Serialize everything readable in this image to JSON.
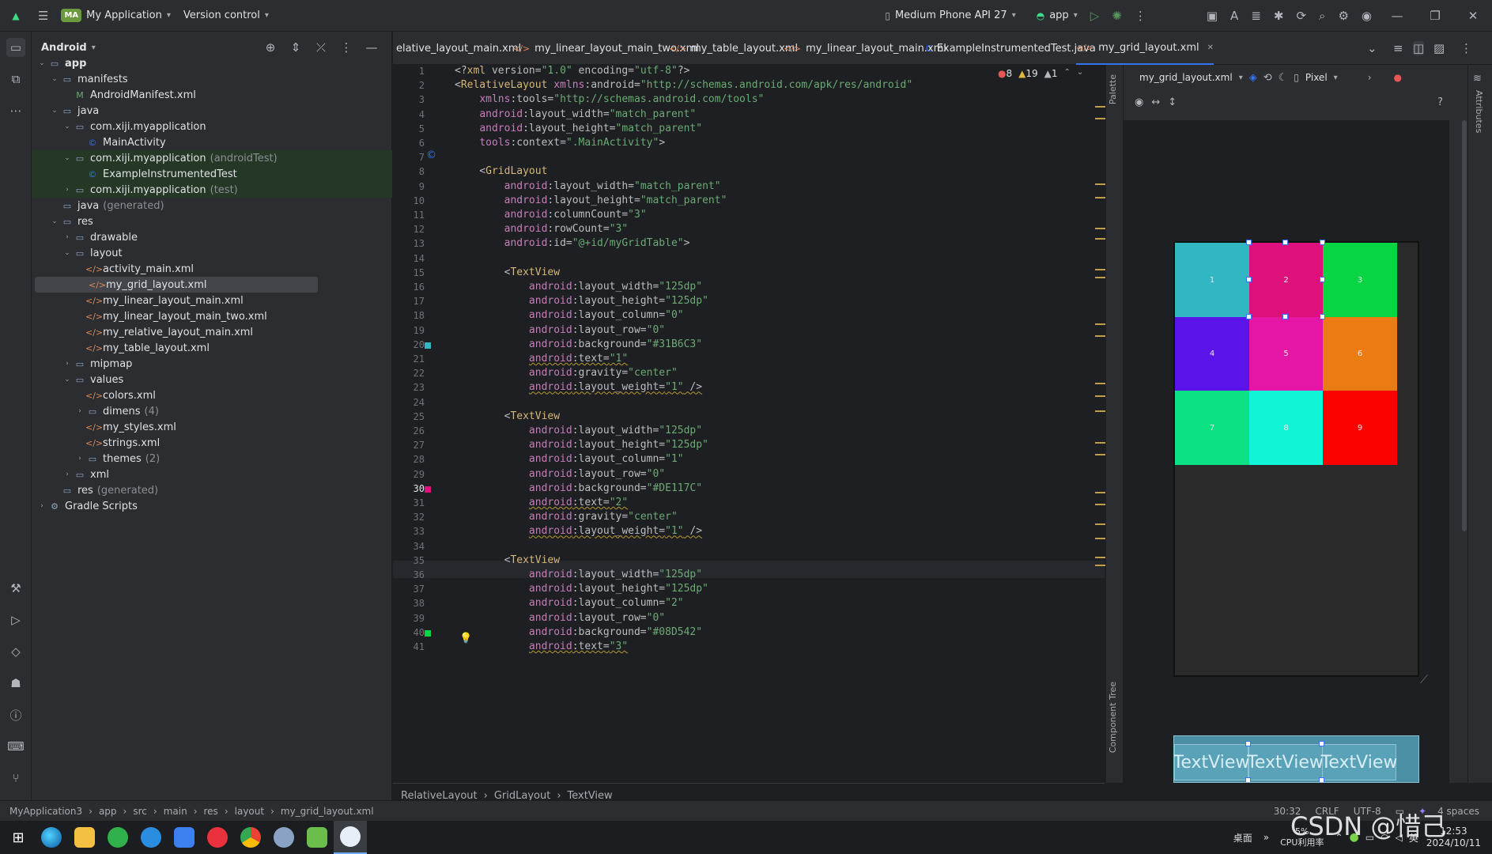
{
  "titlebar": {
    "app_badge": "MA",
    "app_name": "My Application",
    "vcs": "Version control",
    "device": "Medium Phone API 27",
    "run_config": "app"
  },
  "project": {
    "view": "Android",
    "tree": [
      {
        "label": "app",
        "depth": 0,
        "arrow": "v",
        "icon": "folder",
        "bold": true
      },
      {
        "label": "manifests",
        "depth": 1,
        "arrow": "v",
        "icon": "folder"
      },
      {
        "label": "AndroidManifest.xml",
        "depth": 2,
        "arrow": "",
        "icon": "manifest"
      },
      {
        "label": "java",
        "depth": 1,
        "arrow": "v",
        "icon": "folder"
      },
      {
        "label": "com.xiji.myapplication",
        "depth": 2,
        "arrow": "v",
        "icon": "package"
      },
      {
        "label": "MainActivity",
        "depth": 3,
        "arrow": "",
        "icon": "class"
      },
      {
        "label": "com.xiji.myapplication",
        "depth": 2,
        "arrow": "v",
        "icon": "package",
        "suffix": "(androidTest)",
        "green": true
      },
      {
        "label": "ExampleInstrumentedTest",
        "depth": 3,
        "arrow": "",
        "icon": "class",
        "green": true
      },
      {
        "label": "com.xiji.myapplication",
        "depth": 2,
        "arrow": ">",
        "icon": "package",
        "suffix": "(test)",
        "green": true
      },
      {
        "label": "java",
        "depth": 1,
        "arrow": "",
        "icon": "folder",
        "suffix": "(generated)"
      },
      {
        "label": "res",
        "depth": 1,
        "arrow": "v",
        "icon": "folder"
      },
      {
        "label": "drawable",
        "depth": 2,
        "arrow": ">",
        "icon": "folder"
      },
      {
        "label": "layout",
        "depth": 2,
        "arrow": "v",
        "icon": "folder"
      },
      {
        "label": "activity_main.xml",
        "depth": 3,
        "arrow": "",
        "icon": "xml"
      },
      {
        "label": "my_grid_layout.xml",
        "depth": 3,
        "arrow": "",
        "icon": "xml",
        "selected": true
      },
      {
        "label": "my_linear_layout_main.xml",
        "depth": 3,
        "arrow": "",
        "icon": "xml"
      },
      {
        "label": "my_linear_layout_main_two.xml",
        "depth": 3,
        "arrow": "",
        "icon": "xml"
      },
      {
        "label": "my_relative_layout_main.xml",
        "depth": 3,
        "arrow": "",
        "icon": "xml"
      },
      {
        "label": "my_table_layout.xml",
        "depth": 3,
        "arrow": "",
        "icon": "xml"
      },
      {
        "label": "mipmap",
        "depth": 2,
        "arrow": ">",
        "icon": "folder"
      },
      {
        "label": "values",
        "depth": 2,
        "arrow": "v",
        "icon": "folder"
      },
      {
        "label": "colors.xml",
        "depth": 3,
        "arrow": "",
        "icon": "xml"
      },
      {
        "label": "dimens",
        "depth": 3,
        "arrow": ">",
        "icon": "folder",
        "suffix": "(4)"
      },
      {
        "label": "my_styles.xml",
        "depth": 3,
        "arrow": "",
        "icon": "xml"
      },
      {
        "label": "strings.xml",
        "depth": 3,
        "arrow": "",
        "icon": "xml"
      },
      {
        "label": "themes",
        "depth": 3,
        "arrow": ">",
        "icon": "folder",
        "suffix": "(2)"
      },
      {
        "label": "xml",
        "depth": 2,
        "arrow": ">",
        "icon": "folder"
      },
      {
        "label": "res",
        "depth": 1,
        "arrow": "",
        "icon": "folder",
        "suffix": "(generated)"
      },
      {
        "label": "Gradle Scripts",
        "depth": 0,
        "arrow": ">",
        "icon": "gradle"
      }
    ]
  },
  "tabs": [
    {
      "label": "elative_layout_main.xml",
      "icon": "",
      "active": false
    },
    {
      "label": "my_linear_layout_main_two.xml",
      "icon": "</>",
      "active": false
    },
    {
      "label": "my_table_layout.xml",
      "icon": "</>",
      "active": false
    },
    {
      "label": "my_linear_layout_main.xml",
      "icon": "</>",
      "active": false
    },
    {
      "label": "ExampleInstrumentedTest.java",
      "icon": "C",
      "active": false
    },
    {
      "label": "my_grid_layout.xml",
      "icon": "</>",
      "active": true
    }
  ],
  "inspections": {
    "errors": "8",
    "warnings": "19",
    "weak": "1"
  },
  "code": [
    "<?xml version=\"1.0\" encoding=\"utf-8\"?>",
    "<RelativeLayout xmlns:android=\"http://schemas.android.com/apk/res/android\"",
    "    xmlns:tools=\"http://schemas.android.com/tools\"",
    "    android:layout_width=\"match_parent\"",
    "    android:layout_height=\"match_parent\"",
    "    tools:context=\".MainActivity\">",
    "",
    "    <GridLayout",
    "        android:layout_width=\"match_parent\"",
    "        android:layout_height=\"match_parent\"",
    "        android:columnCount=\"3\"",
    "        android:rowCount=\"3\"",
    "        android:id=\"@+id/myGridTable\">",
    "",
    "        <TextView",
    "            android:layout_width=\"125dp\"",
    "            android:layout_height=\"125dp\"",
    "            android:layout_column=\"0\"",
    "            android:layout_row=\"0\"",
    "            android:background=\"#31B6C3\"",
    "            android:text=\"1\"",
    "            android:gravity=\"center\"",
    "            android:layout_weight=\"1\" />",
    "",
    "        <TextView",
    "            android:layout_width=\"125dp\"",
    "            android:layout_height=\"125dp\"",
    "            android:layout_column=\"1\"",
    "            android:layout_row=\"0\"",
    "            android:background=\"#DE117C\"",
    "            android:text=\"2\"",
    "            android:gravity=\"center\"",
    "            android:layout_weight=\"1\" />",
    "",
    "        <TextView",
    "            android:layout_width=\"125dp\"",
    "            android:layout_height=\"125dp\"",
    "            android:layout_column=\"2\"",
    "            android:layout_row=\"0\"",
    "            android:background=\"#08D542\"",
    "            android:text=\"3\""
  ],
  "swatches": {
    "20": "#31B6C3",
    "30": "#DE117C",
    "40": "#08D542"
  },
  "preview": {
    "file": "my_grid_layout.xml",
    "device": "Pixel",
    "palette_label": "Palette",
    "component_tree_label": "Component Tree",
    "attributes_label": "Attributes",
    "cells": [
      {
        "text": "1",
        "color": "#31B6C3"
      },
      {
        "text": "2",
        "color": "#DE117C"
      },
      {
        "text": "3",
        "color": "#08D542"
      },
      {
        "text": "4",
        "color": "#5A13E8"
      },
      {
        "text": "5",
        "color": "#E515A6"
      },
      {
        "text": "6",
        "color": "#EB7B13"
      },
      {
        "text": "7",
        "color": "#0CE183"
      },
      {
        "text": "8",
        "color": "#11F5D7"
      },
      {
        "text": "9",
        "color": "#FA0000"
      }
    ],
    "blueprint_label": "TextView"
  },
  "breadcrumb": [
    "RelativeLayout",
    "GridLayout",
    "TextView"
  ],
  "status": {
    "path": [
      "MyApplication3",
      "app",
      "src",
      "main",
      "res",
      "layout",
      "my_grid_layout.xml"
    ],
    "position": "30:32",
    "line_sep": "CRLF",
    "encoding": "UTF-8",
    "indent": "4 spaces"
  },
  "taskbar": {
    "desktop": "桌面",
    "cpu": "5%",
    "cpu_label": "CPU利用率",
    "ime": "英",
    "time": "12:53",
    "date": "2024/10/11",
    "watermark": "CSDN @惜己"
  }
}
